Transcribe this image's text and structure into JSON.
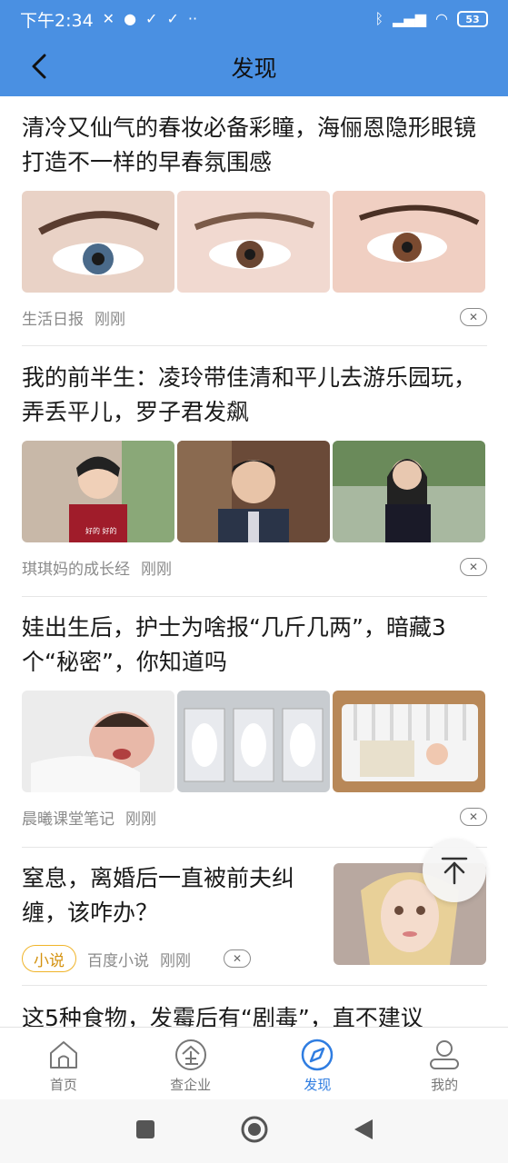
{
  "status_bar": {
    "time": "下午2:34",
    "battery": "53"
  },
  "header": {
    "title": "发现"
  },
  "articles": [
    {
      "headline": "清冷又仙气的春妆必备彩瞳，海俪恩隐形眼镜打造不一样的早春氛围感",
      "source": "生活日报",
      "time": "刚刚"
    },
    {
      "headline": "我的前半生：凌玲带佳清和平儿去游乐园玩，弄丢平儿，罗子君发飙",
      "source": "琪琪妈的成长经",
      "time": "刚刚",
      "image_captions": [
        "好的 好的"
      ]
    },
    {
      "headline": "娃出生后，护士为啥报“几斤几两”，暗藏3个“秘密”，你知道吗",
      "source": "晨曦课堂笔记",
      "time": "刚刚"
    },
    {
      "headline": "窒息，离婚后一直被前夫纠缠，该咋办？",
      "tag": "小说",
      "source": "百度小说",
      "time": "刚刚"
    },
    {
      "headline": "这5种食物，发霉后有“剧毒”，直不建议"
    }
  ],
  "tabbar": {
    "items": [
      {
        "label": "首页",
        "icon": "home-icon"
      },
      {
        "label": "查企业",
        "icon": "enterprise-icon"
      },
      {
        "label": "发现",
        "icon": "compass-icon",
        "active": true
      },
      {
        "label": "我的",
        "icon": "profile-icon"
      }
    ]
  },
  "colors": {
    "header_bg": "#4a90e2",
    "accent": "#2f7de1",
    "tag_border": "#f0b429"
  }
}
